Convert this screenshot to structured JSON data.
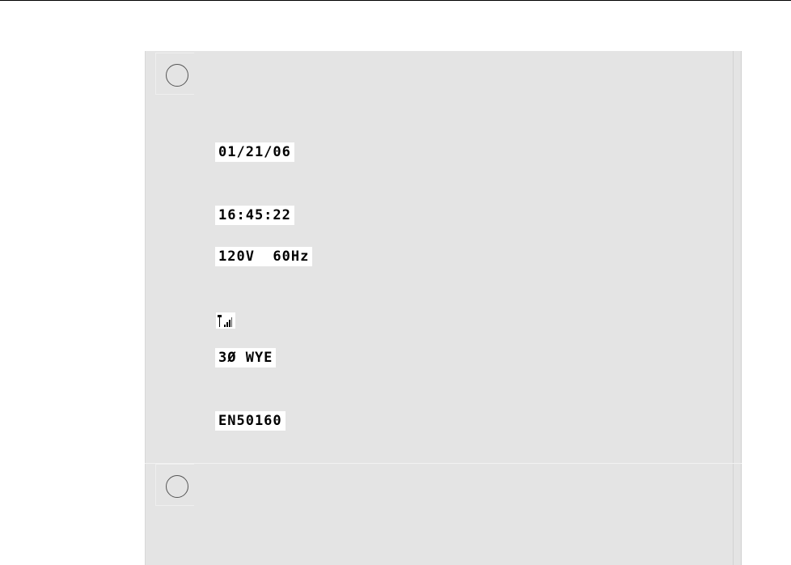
{
  "display": {
    "date": "01/21/06",
    "time": "16:45:22",
    "supply": "120V  60Hz",
    "signal_icon": "signal-strength-icon",
    "wiring": "3Ø WYE",
    "limits": "EN50160"
  },
  "colors": {
    "panel_background": "#e4e4e4",
    "lcd_background": "#ffffff",
    "lcd_text": "#000000"
  }
}
